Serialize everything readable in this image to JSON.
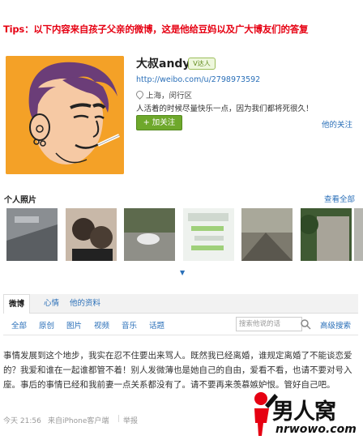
{
  "banner": {
    "text": "Tips：以下内容来自孩子父亲的微博，这是他给豆妈以及广大博友们的答复"
  },
  "profile": {
    "username": "大叔andyu",
    "badge": "V达人",
    "url": "http://weibo.com/u/2798973592",
    "location": "上海，闵行区",
    "bio": "人活着的时候尽量快乐一点，因为我们都将死很久！",
    "follow_button": "+ 加关注",
    "ta_follows": "他的关注"
  },
  "photos": {
    "title": "个人照片",
    "view_all": "查看全部",
    "items": [
      "photo-1",
      "photo-2",
      "photo-3",
      "photo-4",
      "photo-5",
      "photo-6",
      "photo-7"
    ]
  },
  "tabs": [
    {
      "label": "微博",
      "active": true
    },
    {
      "label": "心情",
      "active": false
    },
    {
      "label": "他的资料",
      "active": false
    }
  ],
  "filters": [
    "全部",
    "原创",
    "图片",
    "视频",
    "音乐",
    "话题"
  ],
  "search": {
    "placeholder": "搜索他说的话",
    "advanced": "高级搜索"
  },
  "post": {
    "text": "事情发展到这个地步，我实在忍不住要出来骂人。既然我已经离婚，谁规定离婚了不能谈恋爱的？我爱和谁在一起谁都管不着！别人发微薄也是她自己的自由，爱看不看，也请不要对号入座。事后的事情已经和我前妻一点关系都没有了。请不要再来羡慕嫉妒恨。管好自己吧。",
    "time": "今天 21:56",
    "source": "来自iPhone客户端",
    "report": "举报"
  },
  "watermark": {
    "name": "男人窝",
    "domain": "nrwowo.com"
  },
  "colors": {
    "accent": "#2a6fb8",
    "banner": "#e60012",
    "follow": "#6ea82b",
    "avatar_bg": "#f4a127"
  }
}
